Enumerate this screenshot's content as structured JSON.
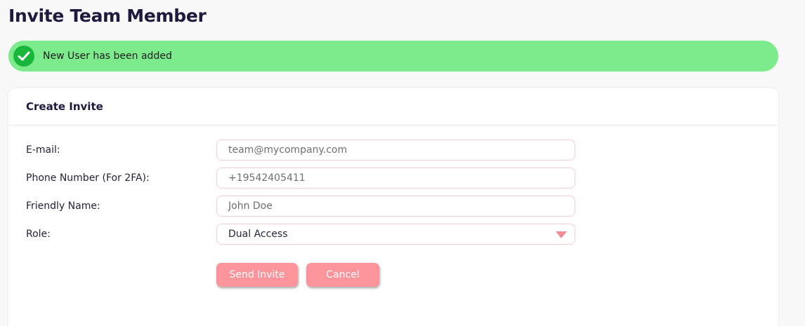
{
  "page": {
    "title": "Invite Team Member"
  },
  "alert": {
    "message": "New User has been added",
    "icon": "check-circle-icon",
    "color": "#7beb8c"
  },
  "card": {
    "title": "Create Invite",
    "fields": {
      "email": {
        "label": "E-mail:",
        "placeholder": "team@mycompany.com"
      },
      "phone": {
        "label": "Phone Number (For 2FA):",
        "placeholder": "+19542405411"
      },
      "friendly_name": {
        "label": "Friendly Name:",
        "placeholder": "John Doe"
      },
      "role": {
        "label": "Role:",
        "selected": "Dual Access"
      }
    },
    "buttons": {
      "send_invite": "Send Invite",
      "cancel": "Cancel"
    }
  },
  "colors": {
    "accent": "#fb959b",
    "input_border": "#f5cdd0",
    "success": "#18b63b"
  }
}
